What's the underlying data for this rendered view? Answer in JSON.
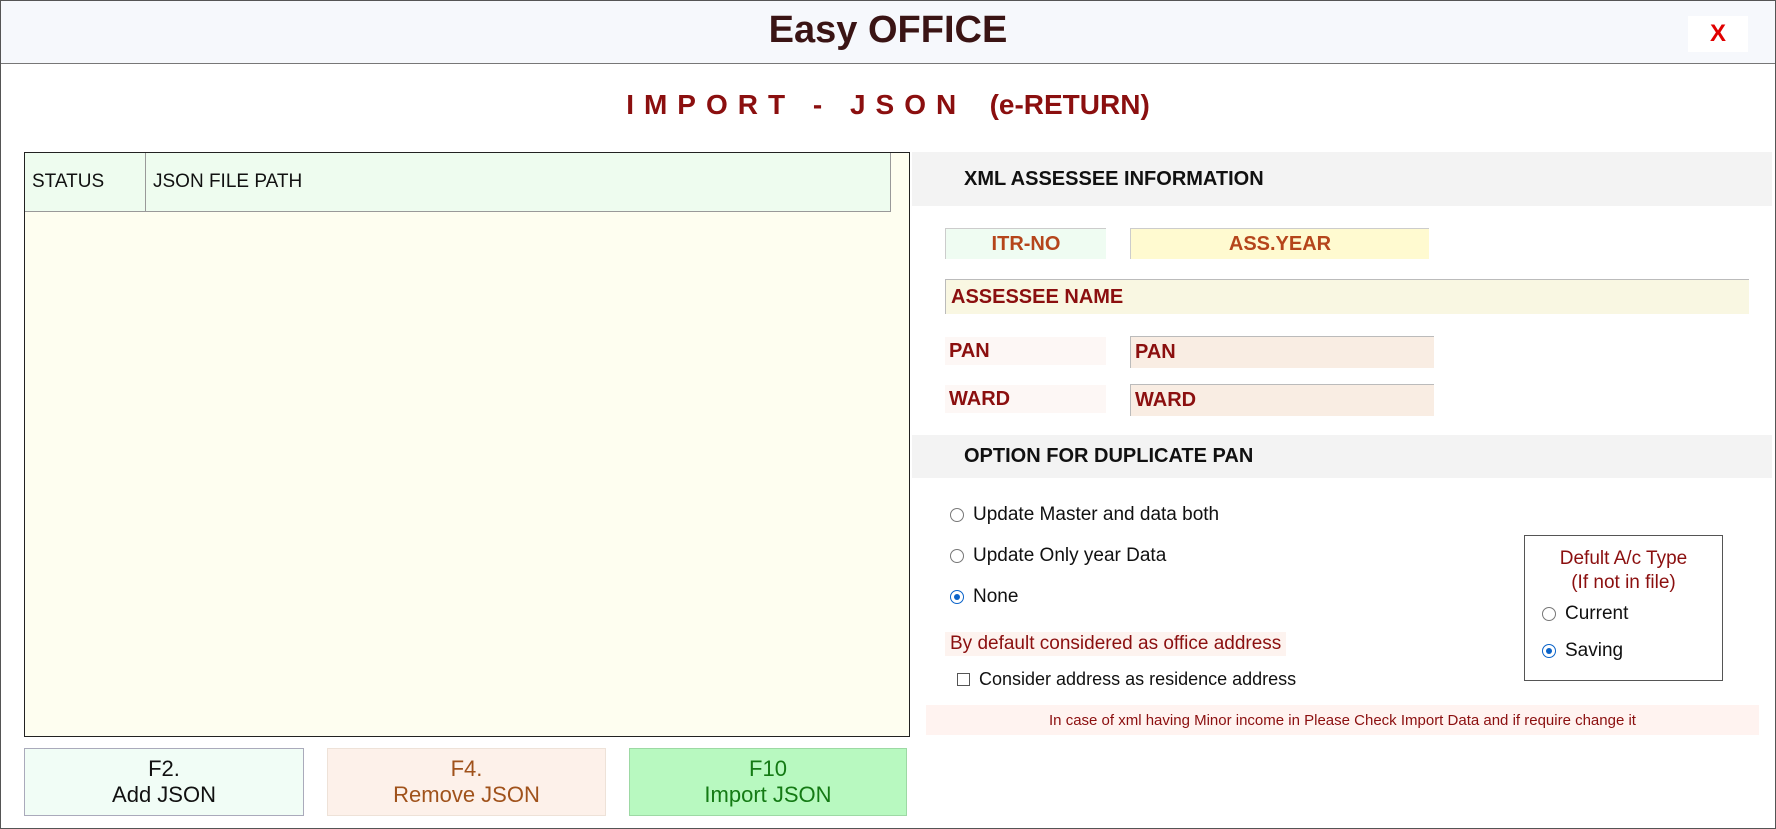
{
  "window": {
    "title": "Easy OFFICE",
    "close_label": "X"
  },
  "heading": {
    "main": "IMPORT - JSON",
    "sub": "(e-RETURN)"
  },
  "file_table": {
    "columns": [
      "STATUS",
      "JSON FILE PATH"
    ],
    "rows": []
  },
  "buttons": {
    "add": {
      "key": "F2.",
      "label": "Add JSON"
    },
    "remove": {
      "key": "F4.",
      "label": "Remove JSON"
    },
    "import": {
      "key": "F10",
      "label": "Import JSON"
    }
  },
  "assessee_info": {
    "section_title": "XML ASSESSEE INFORMATION",
    "itr_no": "ITR-NO",
    "ass_year": "ASS.YEAR",
    "assessee_name": "ASSESSEE NAME",
    "pan_label": "PAN",
    "pan_value": "PAN",
    "ward_label": "WARD",
    "ward_value": "WARD"
  },
  "duplicate_pan": {
    "section_title": "OPTION FOR DUPLICATE PAN",
    "options": [
      {
        "label": "Update Master and data both",
        "checked": false
      },
      {
        "label": "Update Only year Data",
        "checked": false
      },
      {
        "label": "None",
        "checked": true
      }
    ]
  },
  "address": {
    "note": "By default considered as office address",
    "checkbox_label": "Consider address as residence address",
    "checkbox_checked": false
  },
  "account_type": {
    "title_line1": "Defult A/c Type",
    "title_line2": "(If not in file)",
    "options": [
      {
        "label": "Current",
        "checked": false
      },
      {
        "label": "Saving",
        "checked": true
      }
    ]
  },
  "minor_note": "In case of xml having Minor income in Please Check Import Data and if require change it",
  "colors": {
    "accent_dark_red": "#8b0f0f",
    "radio_blue": "#0a63c9",
    "close_red": "#e00000",
    "import_green": "#b8f9c0"
  }
}
